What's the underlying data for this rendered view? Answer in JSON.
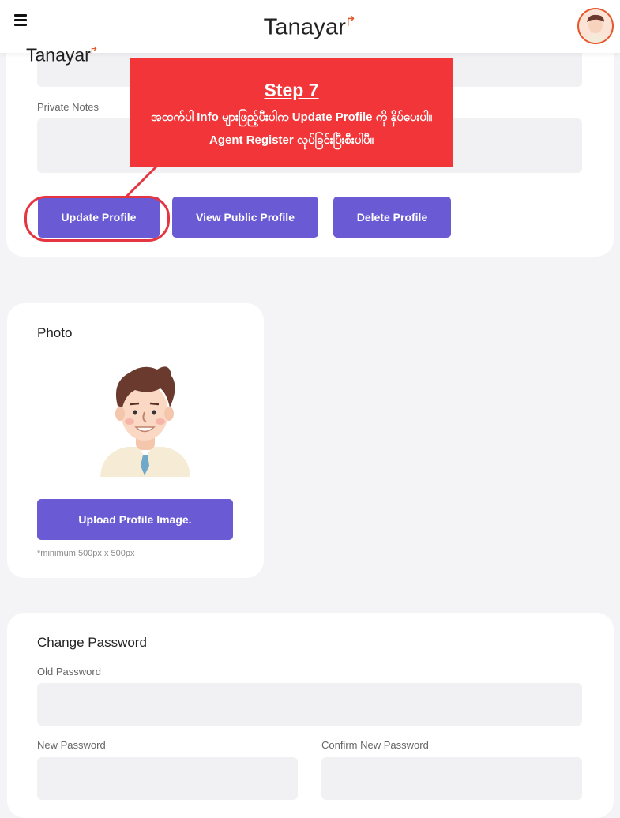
{
  "header": {
    "brand": "Tanayar",
    "brand_mark": "↱",
    "menu_icon": "hamburger-menu-icon",
    "avatar_icon": "user-avatar-icon"
  },
  "watermark": {
    "text": "Tanayar",
    "mark": "↱"
  },
  "profile": {
    "private_notes_label": "Private Notes",
    "buttons": {
      "update": "Update Profile",
      "view_public": "View Public Profile",
      "delete": "Delete Profile"
    }
  },
  "callout": {
    "step": "Step 7",
    "text": "အထက်ပါ Info များဖြည့်ပီးပါက Update Profile ကို နှိပ်ပေးပါ။ Agent Register လုပ်ခြင်းပြီးစီးပါပီ။"
  },
  "photo": {
    "title": "Photo",
    "upload_label": "Upload Profile Image.",
    "hint": "*minimum 500px x 500px"
  },
  "password": {
    "title": "Change Password",
    "old_label": "Old Password",
    "new_label": "New Password",
    "confirm_label": "Confirm New Password"
  },
  "colors": {
    "accent": "#6a5bd4",
    "callout": "#f13538",
    "brand_orange": "#e5572a"
  }
}
